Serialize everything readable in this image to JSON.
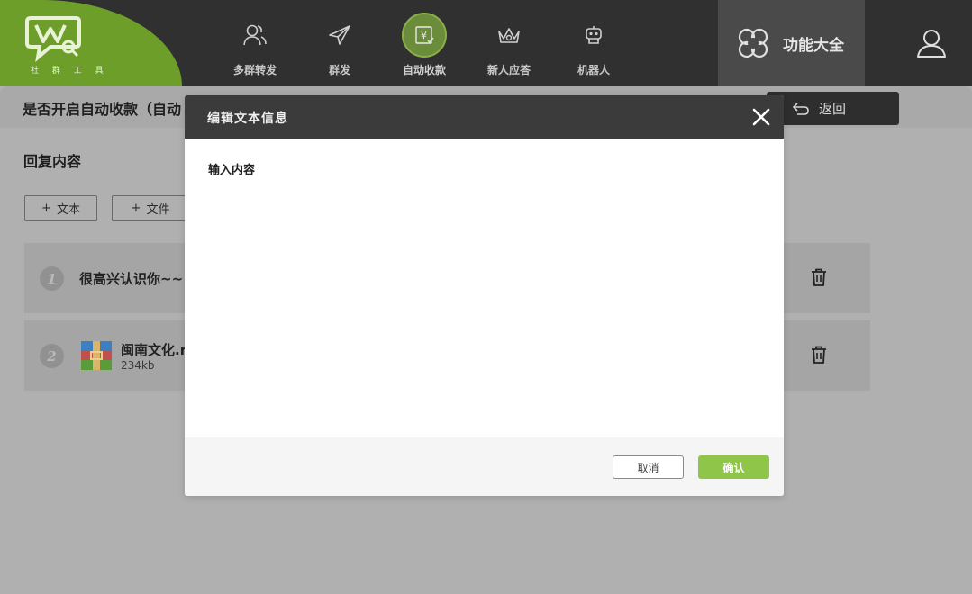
{
  "app": {
    "logo_text": "社 群 工 具"
  },
  "nav": {
    "items": [
      {
        "label": "多群转发",
        "icon": "users-icon"
      },
      {
        "label": "群发",
        "icon": "send-icon"
      },
      {
        "label": "自动收款",
        "icon": "payment-icon",
        "active": true
      },
      {
        "label": "新人应答",
        "icon": "crown-icon"
      },
      {
        "label": "机器人",
        "icon": "robot-icon"
      }
    ],
    "func_all_label": "功能大全"
  },
  "page": {
    "title": "是否开启自动收款（自动",
    "back_label": "返回",
    "section_title": "回复内容",
    "add_text_label": "文本",
    "add_file_label": "文件",
    "replies": [
      {
        "index": "1",
        "type": "text",
        "text": "很高兴认识你~~"
      },
      {
        "index": "2",
        "type": "file",
        "name": "闽南文化.r",
        "size": "234kb"
      }
    ]
  },
  "modal": {
    "title": "编辑文本信息",
    "field_label": "输入内容",
    "field_value": "",
    "cancel_label": "取消",
    "ok_label": "确认"
  },
  "colors": {
    "accent_green": "#8fc64a",
    "topbar": "#303030",
    "modal_header": "#3b3b3b"
  }
}
